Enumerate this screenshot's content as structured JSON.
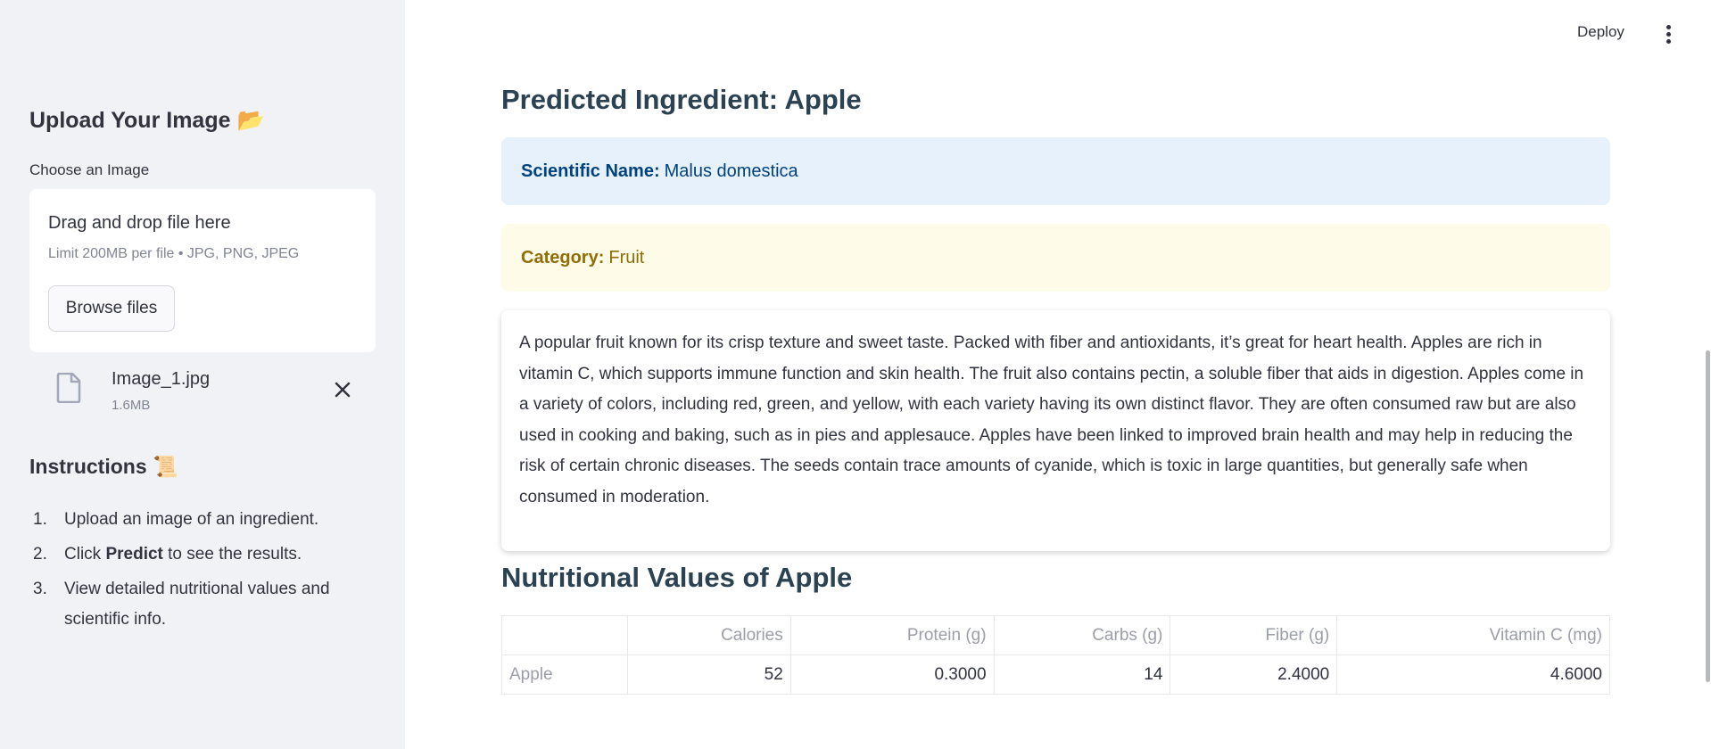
{
  "sidebar": {
    "upload_title": "Upload Your Image",
    "upload_emoji": "📂",
    "choose_label": "Choose an Image",
    "dropzone": {
      "title": "Drag and drop file here",
      "limit": "Limit 200MB per file • JPG, PNG, JPEG",
      "browse_label": "Browse files"
    },
    "file": {
      "name": "Image_1.jpg",
      "size": "1.6MB"
    },
    "instructions_title": "Instructions",
    "instructions_emoji": "📜",
    "instructions": [
      {
        "num": "1.",
        "before": "Upload an image of an ingredient.",
        "bold": "",
        "after": ""
      },
      {
        "num": "2.",
        "before": "Click ",
        "bold": "Predict",
        "after": " to see the results."
      },
      {
        "num": "3.",
        "before": "View detailed nutritional values and scientific info.",
        "bold": "",
        "after": ""
      }
    ]
  },
  "header": {
    "deploy_label": "Deploy"
  },
  "main": {
    "predicted_title": "Predicted Ingredient: Apple",
    "scientific_label": "Scientific Name:",
    "scientific_value": "Malus domestica",
    "category_label": "Category:",
    "category_value": "Fruit",
    "description": "A popular fruit known for its crisp texture and sweet taste. Packed with fiber and antioxidants, it’s great for heart health. Apples are rich in vitamin C, which supports immune function and skin health. The fruit also contains pectin, a soluble fiber that aids in digestion. Apples come in a variety of colors, including red, green, and yellow, with each variety having its own distinct flavor. They are often consumed raw but are also used in cooking and baking, such as in pies and applesauce. Apples have been linked to improved brain health and may help in reducing the risk of certain chronic diseases. The seeds contain trace amounts of cyanide, which is toxic in large quantities, but generally safe when consumed in moderation.",
    "nutrition_title": "Nutritional Values of Apple",
    "table": {
      "columns": [
        "",
        "Calories",
        "Protein (g)",
        "Carbs (g)",
        "Fiber (g)",
        "Vitamin C (mg)"
      ],
      "rows": [
        [
          "Apple",
          "52",
          "0.3000",
          "14",
          "2.4000",
          "4.6000"
        ]
      ]
    }
  },
  "colors": {
    "sidebar_bg": "#f0f2f6",
    "info_bg": "#e7f1fb",
    "info_text": "#004280",
    "warning_bg": "#fefce9",
    "warning_text": "#926c05",
    "heading": "#2b4252"
  },
  "icons": {
    "file": "file-icon",
    "close": "close-icon",
    "menu": "kebab-menu-icon"
  }
}
